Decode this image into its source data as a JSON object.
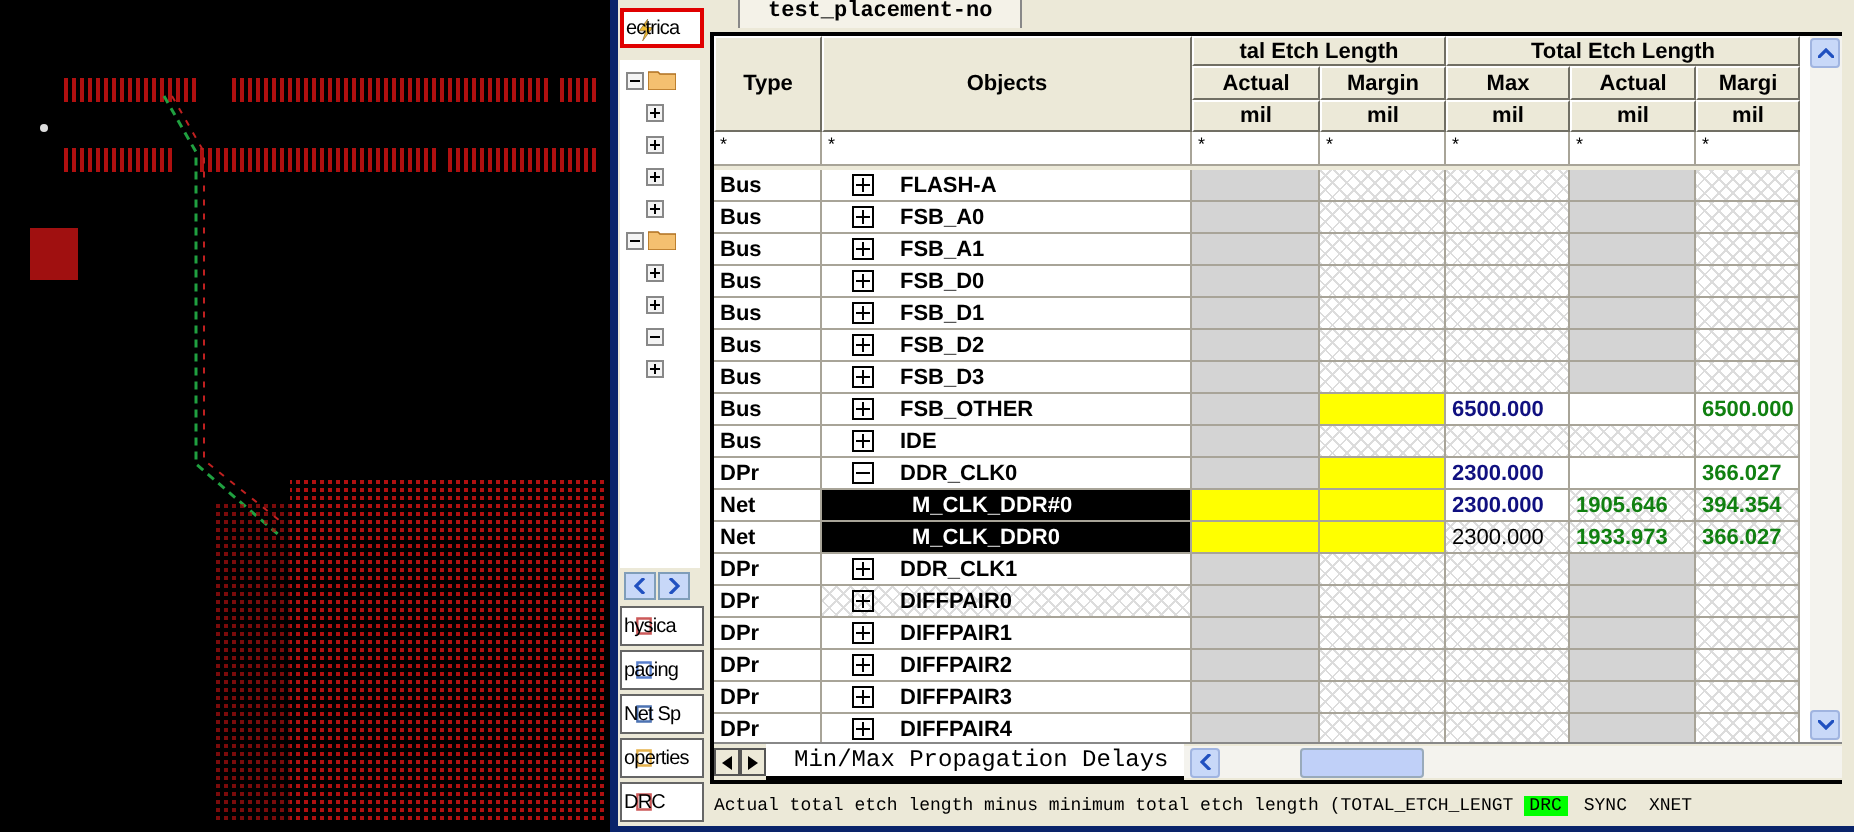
{
  "sidebar": {
    "top_tab": {
      "label": "ectrica",
      "selected": true
    },
    "tree": [
      {
        "expanded": true,
        "children": [
          {
            "expanded": false
          },
          {
            "expanded": false
          },
          {
            "expanded": false
          },
          {
            "expanded": false
          }
        ]
      },
      {
        "expanded": true,
        "children": [
          {
            "expanded": false
          },
          {
            "expanded": false
          },
          {
            "expanded": true
          },
          {
            "expanded": false
          }
        ]
      }
    ],
    "bottom_tabs": [
      {
        "label": "hysica",
        "selected": false
      },
      {
        "label": "pacing",
        "selected": false
      },
      {
        "label": "Net Sp",
        "selected": false
      },
      {
        "label": "operties",
        "selected": false
      },
      {
        "label": "DRC",
        "selected": false
      }
    ]
  },
  "document_tab": {
    "label": "test_placement-no",
    "selected": true
  },
  "table": {
    "column_groups": [
      {
        "label": "tal Etch Length"
      },
      {
        "label": "Total Etch Length"
      }
    ],
    "columns": [
      {
        "label": "Type"
      },
      {
        "label": "Objects"
      },
      {
        "label": "Actual",
        "unit": "mil"
      },
      {
        "label": "Margin",
        "unit": "mil"
      },
      {
        "label": "Max",
        "unit": "mil"
      },
      {
        "label": "Actual",
        "unit": "mil"
      },
      {
        "label": "Margi",
        "unit": "mil"
      }
    ],
    "filters": [
      "*",
      "*",
      "*",
      "*",
      "*",
      "*",
      "*"
    ],
    "rows": [
      {
        "expanded": false,
        "selected": false,
        "cells": [
          {
            "text": "Bus"
          },
          {
            "text": "FLASH-A"
          },
          {
            "kind": "grey"
          },
          {
            "kind": "hatch"
          },
          {
            "kind": "hatch"
          },
          {
            "kind": "grey"
          },
          {
            "kind": "hatch"
          }
        ]
      },
      {
        "expanded": false,
        "selected": false,
        "cells": [
          {
            "text": "Bus"
          },
          {
            "text": "FSB_A0"
          },
          {
            "kind": "grey"
          },
          {
            "kind": "hatch"
          },
          {
            "kind": "hatch"
          },
          {
            "kind": "grey"
          },
          {
            "kind": "hatch"
          }
        ]
      },
      {
        "expanded": false,
        "selected": false,
        "cells": [
          {
            "text": "Bus"
          },
          {
            "text": "FSB_A1"
          },
          {
            "kind": "grey"
          },
          {
            "kind": "hatch"
          },
          {
            "kind": "hatch"
          },
          {
            "kind": "grey"
          },
          {
            "kind": "hatch"
          }
        ]
      },
      {
        "expanded": false,
        "selected": false,
        "cells": [
          {
            "text": "Bus"
          },
          {
            "text": "FSB_D0"
          },
          {
            "kind": "grey"
          },
          {
            "kind": "hatch"
          },
          {
            "kind": "hatch"
          },
          {
            "kind": "grey"
          },
          {
            "kind": "hatch"
          }
        ]
      },
      {
        "expanded": false,
        "selected": false,
        "cells": [
          {
            "text": "Bus"
          },
          {
            "text": "FSB_D1"
          },
          {
            "kind": "grey"
          },
          {
            "kind": "hatch"
          },
          {
            "kind": "hatch"
          },
          {
            "kind": "grey"
          },
          {
            "kind": "hatch"
          }
        ]
      },
      {
        "expanded": false,
        "selected": false,
        "cells": [
          {
            "text": "Bus"
          },
          {
            "text": "FSB_D2"
          },
          {
            "kind": "grey"
          },
          {
            "kind": "hatch"
          },
          {
            "kind": "hatch"
          },
          {
            "kind": "grey"
          },
          {
            "kind": "hatch"
          }
        ]
      },
      {
        "expanded": false,
        "selected": false,
        "cells": [
          {
            "text": "Bus"
          },
          {
            "text": "FSB_D3"
          },
          {
            "kind": "grey"
          },
          {
            "kind": "hatch"
          },
          {
            "kind": "hatch"
          },
          {
            "kind": "grey"
          },
          {
            "kind": "hatch"
          }
        ]
      },
      {
        "expanded": false,
        "selected": false,
        "cells": [
          {
            "text": "Bus"
          },
          {
            "text": "FSB_OTHER"
          },
          {
            "kind": "grey"
          },
          {
            "kind": "yellow"
          },
          {
            "kind": "white",
            "text": "6500.000",
            "color": "#101080",
            "bold": true
          },
          {
            "kind": "white"
          },
          {
            "kind": "white",
            "text": "6500.000",
            "color": "#108010",
            "bold": true
          }
        ]
      },
      {
        "expanded": false,
        "selected": false,
        "cells": [
          {
            "text": "Bus"
          },
          {
            "text": "IDE"
          },
          {
            "kind": "grey"
          },
          {
            "kind": "hatch"
          },
          {
            "kind": "hatch"
          },
          {
            "kind": "hatch"
          },
          {
            "kind": "hatch"
          }
        ]
      },
      {
        "expanded": true,
        "selected": false,
        "cells": [
          {
            "text": "DPr"
          },
          {
            "text": "DDR_CLK0"
          },
          {
            "kind": "grey"
          },
          {
            "kind": "yellow"
          },
          {
            "kind": "white",
            "text": "2300.000",
            "color": "#101080",
            "bold": true
          },
          {
            "kind": "white"
          },
          {
            "kind": "white",
            "text": "366.027",
            "color": "#108010",
            "bold": true
          }
        ],
        "children": [
          {
            "selected": true,
            "cells": [
              {
                "text": "Net"
              },
              {
                "text": "M_CLK_DDR#0"
              },
              {
                "kind": "yellow"
              },
              {
                "kind": "yellow"
              },
              {
                "kind": "white",
                "text": "2300.000",
                "color": "#101080",
                "bold": true
              },
              {
                "kind": "hatch",
                "text": "1905.646",
                "color": "#108010",
                "bold": true
              },
              {
                "kind": "hatch",
                "text": "394.354",
                "color": "#108010",
                "bold": true
              }
            ]
          },
          {
            "selected": true,
            "cells": [
              {
                "text": "Net"
              },
              {
                "text": "M_CLK_DDR0"
              },
              {
                "kind": "yellow"
              },
              {
                "kind": "yellow"
              },
              {
                "kind": "hatch",
                "text": "2300.000",
                "color": "#000000",
                "bold": false
              },
              {
                "kind": "hatch",
                "text": "1933.973",
                "color": "#108010",
                "bold": true
              },
              {
                "kind": "hatch",
                "text": "366.027",
                "color": "#108010",
                "bold": true
              }
            ]
          }
        ]
      },
      {
        "expanded": false,
        "selected": false,
        "cells": [
          {
            "text": "DPr"
          },
          {
            "text": "DDR_CLK1"
          },
          {
            "kind": "grey"
          },
          {
            "kind": "hatch"
          },
          {
            "kind": "hatch"
          },
          {
            "kind": "grey"
          },
          {
            "kind": "hatch"
          }
        ]
      },
      {
        "expanded": false,
        "selected": false,
        "highlighted": true,
        "cells": [
          {
            "text": "DPr"
          },
          {
            "text": "DIFFPAIR0"
          },
          {
            "kind": "grey"
          },
          {
            "kind": "hatch"
          },
          {
            "kind": "hatch"
          },
          {
            "kind": "grey"
          },
          {
            "kind": "hatch"
          }
        ]
      },
      {
        "expanded": false,
        "selected": false,
        "cells": [
          {
            "text": "DPr"
          },
          {
            "text": "DIFFPAIR1"
          },
          {
            "kind": "grey"
          },
          {
            "kind": "hatch"
          },
          {
            "kind": "hatch"
          },
          {
            "kind": "grey"
          },
          {
            "kind": "hatch"
          }
        ]
      },
      {
        "expanded": false,
        "selected": false,
        "cells": [
          {
            "text": "DPr"
          },
          {
            "text": "DIFFPAIR2"
          },
          {
            "kind": "grey"
          },
          {
            "kind": "hatch"
          },
          {
            "kind": "hatch"
          },
          {
            "kind": "grey"
          },
          {
            "kind": "hatch"
          }
        ]
      },
      {
        "expanded": false,
        "selected": false,
        "cells": [
          {
            "text": "DPr"
          },
          {
            "text": "DIFFPAIR3"
          },
          {
            "kind": "grey"
          },
          {
            "kind": "hatch"
          },
          {
            "kind": "hatch"
          },
          {
            "kind": "grey"
          },
          {
            "kind": "hatch"
          }
        ]
      },
      {
        "expanded": false,
        "selected": false,
        "cells": [
          {
            "text": "DPr"
          },
          {
            "text": "DIFFPAIR4"
          },
          {
            "kind": "grey"
          },
          {
            "kind": "hatch"
          },
          {
            "kind": "hatch"
          },
          {
            "kind": "grey"
          },
          {
            "kind": "hatch"
          }
        ]
      }
    ]
  },
  "sheet_tab": {
    "label": "Min/Max Propagation Delays",
    "selected": true
  },
  "status_bar": {
    "message": "Actual total etch length minus minimum total etch length (TOTAL_ETCH_LENGT",
    "indicators": [
      {
        "label": "DRC",
        "on": true
      },
      {
        "label": "SYNC",
        "on": false
      },
      {
        "label": "XNET",
        "on": false
      }
    ]
  }
}
